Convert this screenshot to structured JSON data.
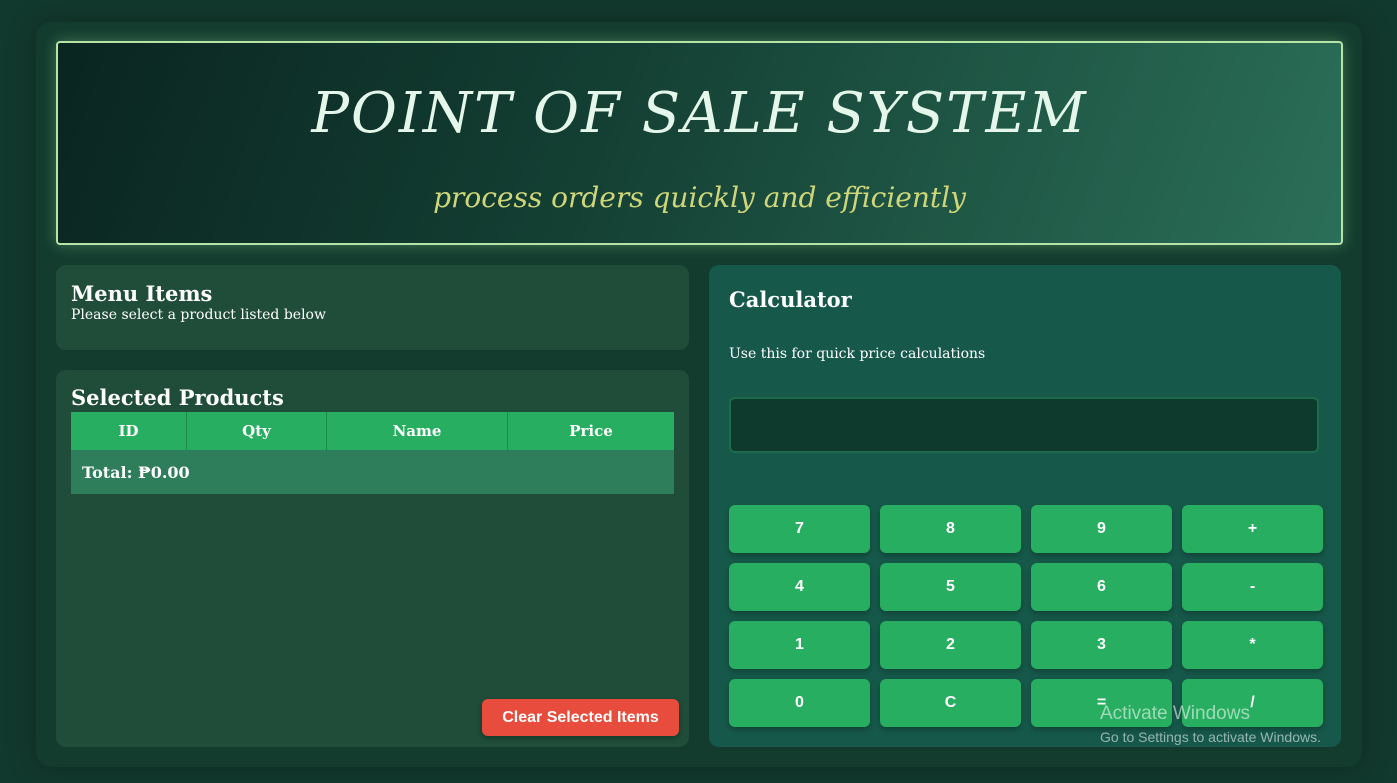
{
  "header": {
    "title": "POINT OF SALE SYSTEM",
    "subtitle": "process orders quickly and efficiently"
  },
  "menu": {
    "title": "Menu Items",
    "description": "Please select a product listed below"
  },
  "selected": {
    "title": "Selected Products",
    "columns": [
      "ID",
      "Qty",
      "Name",
      "Price"
    ],
    "total_label": "Total: ₱0.00",
    "clear_label": "Clear Selected Items"
  },
  "calculator": {
    "title": "Calculator",
    "description": "Use this for quick price calculations",
    "display_value": "",
    "keys": [
      "7",
      "8",
      "9",
      "+",
      "4",
      "5",
      "6",
      "-",
      "1",
      "2",
      "3",
      "*",
      "0",
      "C",
      "=",
      "/"
    ]
  },
  "watermark": {
    "line1": "Activate Windows",
    "line2": "Go to Settings to activate Windows."
  },
  "colors": {
    "accent_green": "#27ae60",
    "danger_red": "#e74c3c",
    "panel_bg": "#1f4d3a"
  }
}
